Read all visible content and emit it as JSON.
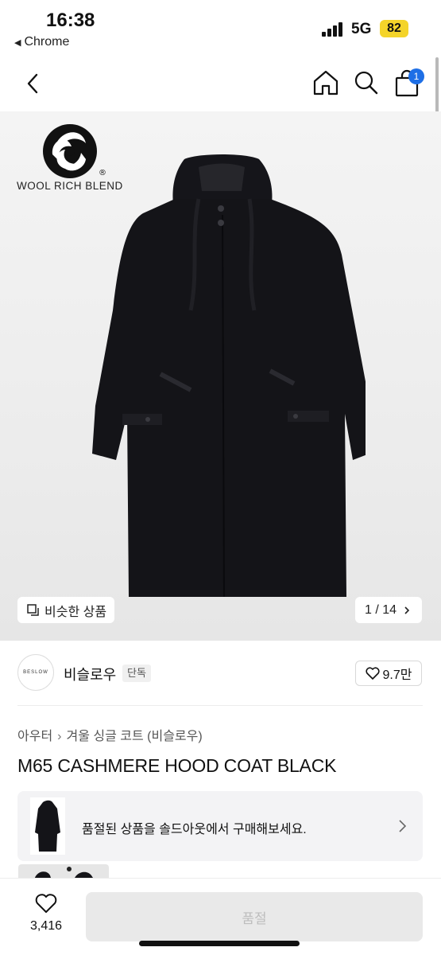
{
  "status_bar": {
    "time": "16:38",
    "back_app": "Chrome",
    "network": "5G",
    "battery": "82"
  },
  "header": {
    "cart_count": "1",
    "badge_color": "#1e6fe6"
  },
  "hero": {
    "wool_mark_text": "WOOL RICH BLEND",
    "similar_label": "비슷한 상품",
    "pager": "1 / 14"
  },
  "seller": {
    "logo_text": "BESLOW",
    "name": "비슬로우",
    "tag": "단독",
    "likes": "9.7만"
  },
  "product": {
    "breadcrumb": [
      "아우터",
      "겨울 싱글 코트 (비슬로우)"
    ],
    "title": "M65 CASHMERE HOOD COAT BLACK",
    "soldout_banner": "품절된 상품을 솔드아웃에서 구매해보세요."
  },
  "bottom": {
    "wish_count": "3,416",
    "cta_label": "품절"
  }
}
